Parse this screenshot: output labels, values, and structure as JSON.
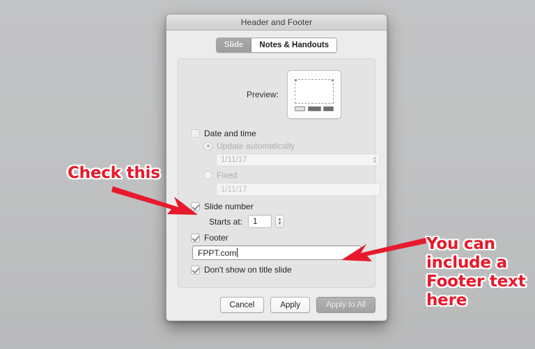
{
  "window": {
    "title": "Header and Footer"
  },
  "tabs": [
    {
      "label": "Slide",
      "selected": true
    },
    {
      "label": "Notes & Handouts",
      "selected": false
    }
  ],
  "preview": {
    "label": "Preview:"
  },
  "form": {
    "date_and_time": {
      "label": "Date and time",
      "checked": false,
      "enabled": false,
      "update_automatically": {
        "label": "Update automatically",
        "selected": true,
        "value": "1/11/17"
      },
      "fixed": {
        "label": "Fixed",
        "selected": false,
        "placeholder": "1/11/17"
      }
    },
    "slide_number": {
      "label": "Slide number",
      "checked": true,
      "starts_at_label": "Starts at:",
      "starts_at_value": "1"
    },
    "footer": {
      "label": "Footer",
      "checked": true,
      "value": "FPPT.com"
    },
    "dont_show_on_title_slide": {
      "label": "Don't show on title slide",
      "checked": true
    }
  },
  "buttons": {
    "cancel": "Cancel",
    "apply": "Apply",
    "apply_to_all": "Apply to All"
  },
  "annotations": {
    "left": "Check this",
    "right_line1": "You can",
    "right_line2": "include a",
    "right_line3": "Footer text",
    "right_line4": "here",
    "color": "#e8192c"
  },
  "stepper": {
    "up": "▴",
    "down": "▾"
  }
}
